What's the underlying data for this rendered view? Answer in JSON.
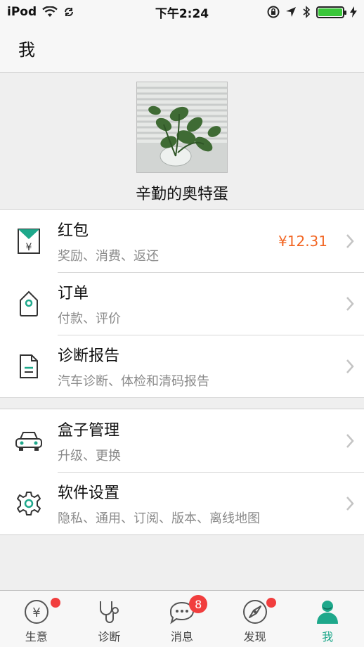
{
  "status_bar": {
    "carrier": "iPod",
    "time": "下午2:24"
  },
  "nav": {
    "title": "我"
  },
  "profile": {
    "username": "辛勤的奥特蛋"
  },
  "menu_group_1": [
    {
      "title": "红包",
      "subtitle": "奖励、消费、返还",
      "value": "¥12.31",
      "icon": "red-packet-icon"
    },
    {
      "title": "订单",
      "subtitle": "付款、评价",
      "icon": "order-tag-icon"
    },
    {
      "title": "诊断报告",
      "subtitle": "汽车诊断、体检和清码报告",
      "icon": "document-icon"
    }
  ],
  "menu_group_2": [
    {
      "title": "盒子管理",
      "subtitle": "升级、更换",
      "icon": "car-icon"
    },
    {
      "title": "软件设置",
      "subtitle": "隐私、通用、订阅、版本、离线地图",
      "icon": "gear-icon"
    }
  ],
  "tab_bar": {
    "tabs": [
      {
        "label": "生意",
        "icon": "yen-coin-icon"
      },
      {
        "label": "诊断",
        "icon": "stethoscope-icon"
      },
      {
        "label": "消息",
        "icon": "chat-icon",
        "badge": "8"
      },
      {
        "label": "发现",
        "icon": "compass-icon"
      },
      {
        "label": "我",
        "icon": "person-icon"
      }
    ]
  },
  "colors": {
    "accent": "#1ea88b",
    "price": "#f26522",
    "badge": "#f13e3e"
  }
}
